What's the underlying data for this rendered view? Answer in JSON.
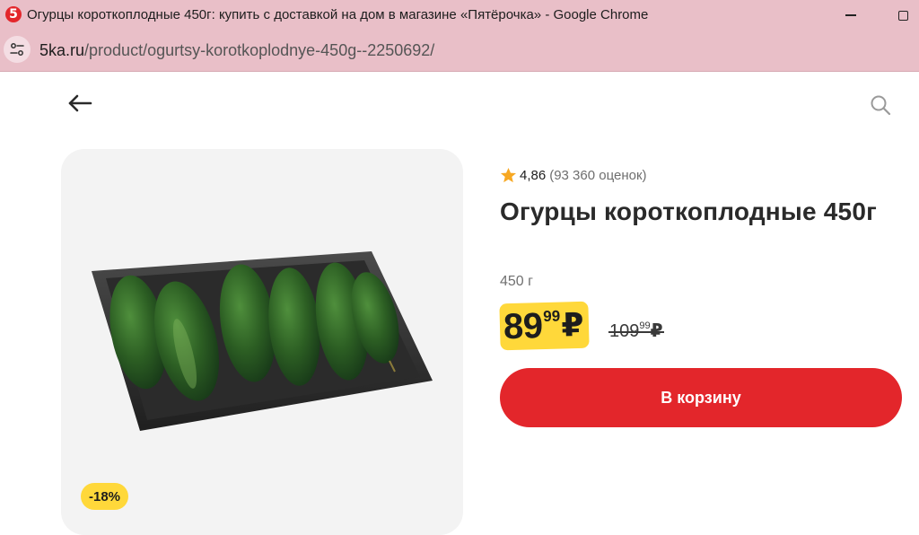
{
  "window": {
    "favicon_text": "5",
    "title": "Огурцы короткоплодные 450г: купить с доставкой на дом в магазине «Пятёрочка» - Google Chrome"
  },
  "addressbar": {
    "host": "5ka.ru",
    "path": "/product/ogurtsy-korotkoplodnye-450g--2250692/"
  },
  "product": {
    "discount": "-18%",
    "rating": "4,86",
    "rating_count": "(93 360 оценок)",
    "title": "Огурцы короткоплодные 450г",
    "weight": "450 г",
    "price": {
      "rubles": "89",
      "kopecks": "99",
      "currency": "₽"
    },
    "old_price": {
      "rubles": "109",
      "kopecks": "99",
      "currency": "₽"
    },
    "cart_label": "В корзину"
  },
  "colors": {
    "brand_red": "#e3262b",
    "price_yellow": "#ffd83a",
    "star": "#f7a823",
    "titlebar": "#e9bfc8"
  },
  "icons": [
    "back-arrow-icon",
    "search-icon",
    "star-icon",
    "site-info-icon",
    "minimize-icon",
    "maximize-icon"
  ]
}
